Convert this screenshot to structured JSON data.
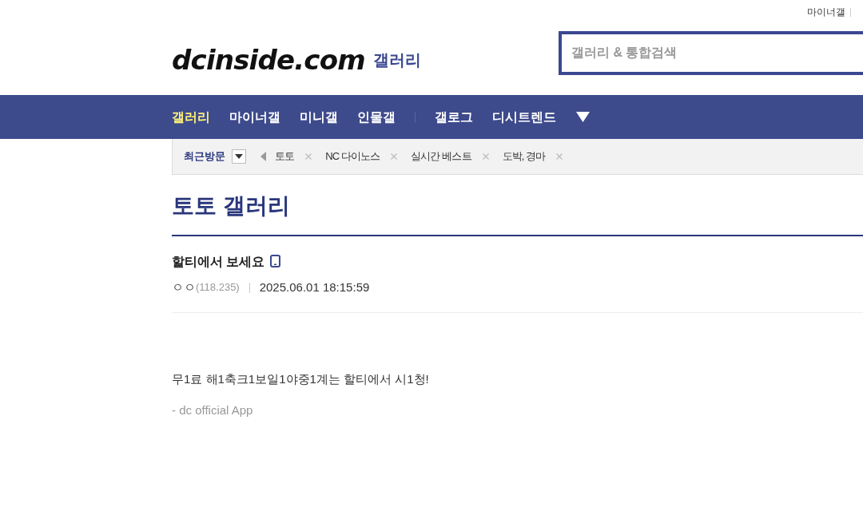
{
  "top_links": [
    {
      "label": "마이너갤"
    }
  ],
  "logo": {
    "text": "dcinside.com",
    "suffix": "갤러리"
  },
  "search": {
    "placeholder": "갤러리 & 통합검색"
  },
  "nav_groups": [
    {
      "items": [
        {
          "label": "갤러리",
          "selected": true
        },
        {
          "label": "마이너갤",
          "selected": false
        },
        {
          "label": "미니갤",
          "selected": false
        },
        {
          "label": "인물갤",
          "selected": false
        }
      ]
    },
    {
      "items": [
        {
          "label": "갤로그",
          "selected": false
        },
        {
          "label": "디시트렌드",
          "selected": false
        }
      ]
    }
  ],
  "recent_visits": {
    "label": "최근방문",
    "items": [
      {
        "label": "토토"
      },
      {
        "label": "NC 다이노스"
      },
      {
        "label": "실시간 베스트"
      },
      {
        "label": "도박, 경마"
      }
    ]
  },
  "gallery_title": "토토 갤러리",
  "post": {
    "title": "할티에서 보세요",
    "from_mobile": true,
    "author": "ㅇㅇ",
    "ip": "(118.235)",
    "date": "2025.06.01 18:15:59",
    "body": [
      "무1료 해1축크1보일1야중1계는 할티에서 시1청!"
    ],
    "signature": "- dc official App"
  }
}
